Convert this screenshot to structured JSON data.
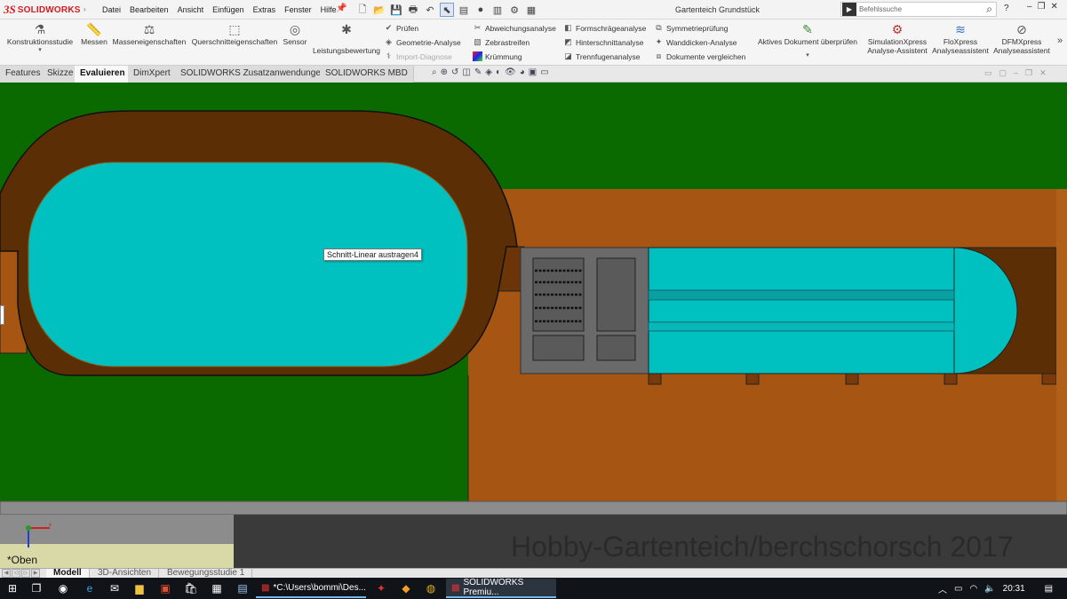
{
  "app": {
    "brand_ds": "3S",
    "brand_name": "SOLIDWORKS",
    "document_title": "Gartenteich Grundstück"
  },
  "menu": [
    "Datei",
    "Bearbeiten",
    "Ansicht",
    "Einfügen",
    "Extras",
    "Fenster",
    "Hilfe"
  ],
  "search": {
    "placeholder": "Befehlssuche"
  },
  "help_label": "?",
  "ribbon": {
    "konstruktionsstudie": "Konstruktionsstudie",
    "messen": "Messen",
    "masseneigenschaften": "Masseneigenschaften",
    "querschnitteigenschaften": "Querschnitteigenschaften",
    "sensor": "Sensor",
    "leistungsbewertung": "Leistungsbewertung",
    "col1": [
      "Prüfen",
      "Geometrie-Analyse",
      "Import-Diagnose"
    ],
    "col2": [
      "Abweichungsanalyse",
      "Zebrastreifen",
      "Krümmung"
    ],
    "col3": [
      "Formschrägeanalyse",
      "Hinterschnittanalyse",
      "Trennfugenanalyse"
    ],
    "col4": [
      "Symmetrieprüfung",
      "Wanddicken-Analyse",
      "Dokumente vergleichen"
    ],
    "aktives_dokument": "Aktives Dokument überprüfen",
    "simulationxpress": [
      "SimulationXpress",
      "Analyse-Assistent"
    ],
    "floxpress": [
      "FloXpress",
      "Analyseassistent"
    ],
    "dfmxpress": [
      "DFMXpress",
      "Analyseassistent"
    ],
    "more": "»"
  },
  "command_tabs": [
    "Features",
    "Skizze",
    "Evaluieren",
    "DimXpert",
    "SOLIDWORKS Zusatzanwendungen",
    "SOLIDWORKS MBD"
  ],
  "active_command_tab": "Evaluieren",
  "viewport": {
    "tooltip": "Schnitt-Linear austragen4",
    "watermark": "Hobby-Gartenteich/berchschorsch 2017",
    "view_name": "*Oben",
    "colors": {
      "lawn": "#0a6a00",
      "soil": "#a65512",
      "dark_soil": "#5c2e05",
      "water": "#00c0c0",
      "concrete": "#6a6a6a",
      "path": "#8c8c8c",
      "sand": "#d9d9a8",
      "slab": "#3a3a3a"
    }
  },
  "bottom_tabs": [
    "Modell",
    "3D-Ansichten",
    "Bewegungsstudie 1"
  ],
  "active_bottom_tab": "Modell",
  "taskbar": {
    "explorer_window": "*C:\\Users\\bommi\\Des...",
    "solidworks_window": "SOLIDWORKS Premiu...",
    "clock": "20:31"
  }
}
